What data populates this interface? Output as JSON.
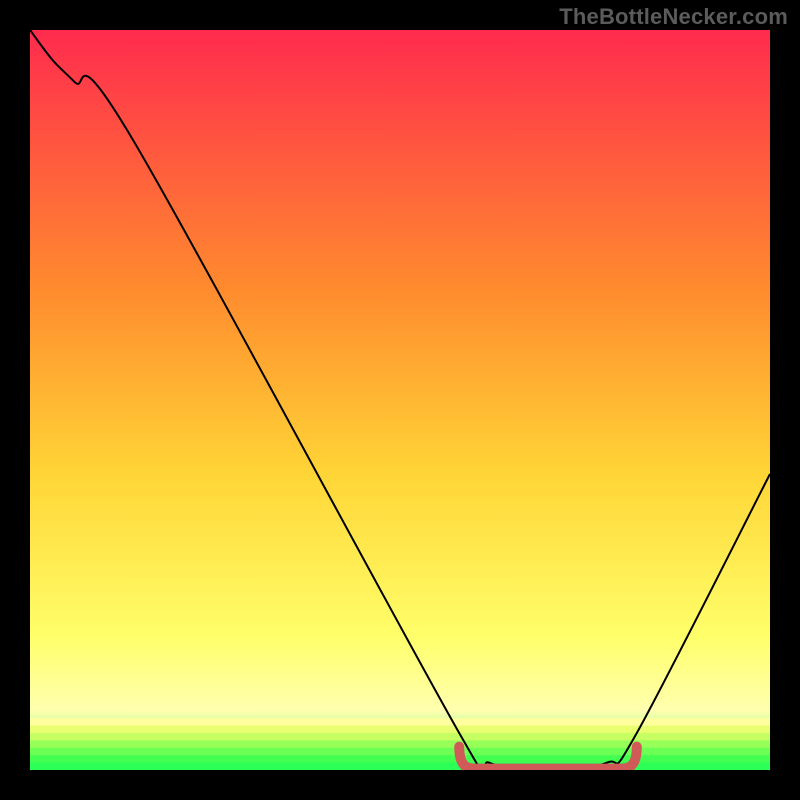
{
  "watermark": "TheBottleNecker.com",
  "colors": {
    "top": "#ff2b4e",
    "mid1": "#ff8b2e",
    "mid2": "#ffd536",
    "mid3": "#ffff6a",
    "bottom_yellow": "#ffffb0",
    "green": "#2bff58",
    "curve": "#000000",
    "marker": "#cf5a57",
    "frame": "#000000"
  },
  "chart_data": {
    "type": "line",
    "title": "",
    "xlabel": "",
    "ylabel": "",
    "xlim": [
      0,
      100
    ],
    "ylim": [
      0,
      100
    ],
    "series": [
      {
        "name": "curve",
        "x": [
          0,
          3,
          6,
          14,
          58,
          62,
          70,
          78,
          82,
          100
        ],
        "values": [
          100,
          96,
          93,
          85,
          5,
          1,
          0,
          1,
          5,
          40
        ]
      }
    ],
    "highlight_segment": {
      "x_start": 58,
      "x_end": 82,
      "y_approx": 1
    },
    "gradient_bands_pct_from_top": [
      {
        "stop": 0,
        "color": "#ff2b4e"
      },
      {
        "stop": 35,
        "color": "#ff8b2e"
      },
      {
        "stop": 60,
        "color": "#ffd536"
      },
      {
        "stop": 82,
        "color": "#ffff6a"
      },
      {
        "stop": 92,
        "color": "#ffffb0"
      },
      {
        "stop": 100,
        "color": "#2bff58"
      }
    ]
  }
}
